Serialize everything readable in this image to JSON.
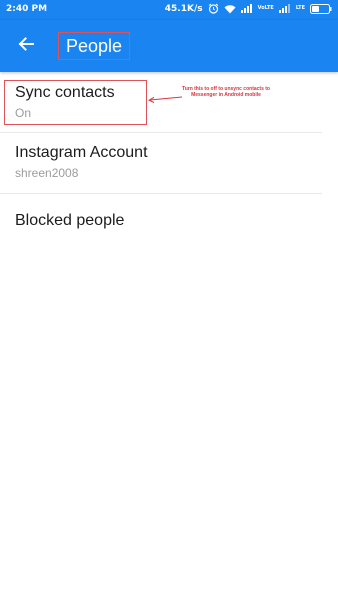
{
  "status_bar": {
    "time": "2:40 PM",
    "network_speed": "45.1K/s",
    "volte_label": "VoLTE",
    "lte_label": "LTE",
    "icons": [
      "alarm-icon",
      "wifi-icon",
      "signal-icon",
      "volte-icon",
      "signal-icon",
      "battery-icon"
    ]
  },
  "app_bar": {
    "back_icon": "arrow-left-icon",
    "title": "People"
  },
  "settings": [
    {
      "title": "Sync contacts",
      "subtitle": "On"
    },
    {
      "title": "Instagram Account",
      "subtitle": "shreen2008"
    },
    {
      "title": "Blocked people"
    }
  ],
  "annotation": {
    "text": "Turn this to off to unsync contacts to Messenger in Android mobile",
    "color": "#d8353d"
  },
  "colors": {
    "primary": "#1a84f0",
    "highlight_border": "#e0525a",
    "title_text": "#1c1c1c",
    "subtitle_text": "#9c9c9c"
  }
}
